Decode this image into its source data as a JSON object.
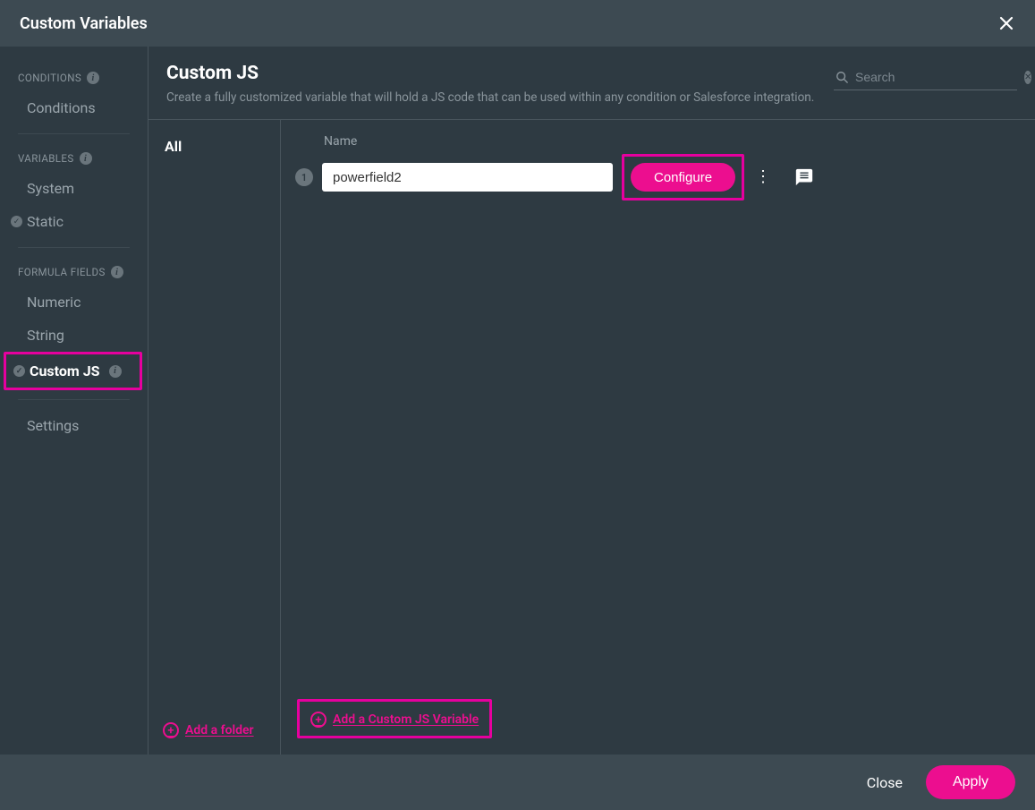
{
  "titlebar": {
    "title": "Custom Variables"
  },
  "sidebar": {
    "sections": [
      {
        "header": "CONDITIONS",
        "items": [
          {
            "label": "Conditions",
            "checked": false
          }
        ]
      },
      {
        "header": "VARIABLES",
        "items": [
          {
            "label": "System",
            "checked": false
          },
          {
            "label": "Static",
            "checked": true
          }
        ]
      },
      {
        "header": "FORMULA FIELDS",
        "items": [
          {
            "label": "Numeric",
            "checked": false
          },
          {
            "label": "String",
            "checked": false
          },
          {
            "label": "Custom JS",
            "checked": true,
            "active": true,
            "info": true
          }
        ]
      }
    ],
    "settings_label": "Settings"
  },
  "main": {
    "title": "Custom JS",
    "subtitle": "Create a fully customized variable that will hold a JS code that can be used within any condition or Salesforce integration.",
    "search_placeholder": "Search"
  },
  "folders": {
    "items": [
      {
        "label": "All"
      }
    ],
    "add_label": "Add a folder"
  },
  "variables": {
    "name_header": "Name",
    "rows": [
      {
        "index": "1",
        "name": "powerfield2",
        "configure_label": "Configure"
      }
    ],
    "add_label": "Add a Custom JS Variable"
  },
  "footer": {
    "close_label": "Close",
    "apply_label": "Apply"
  }
}
